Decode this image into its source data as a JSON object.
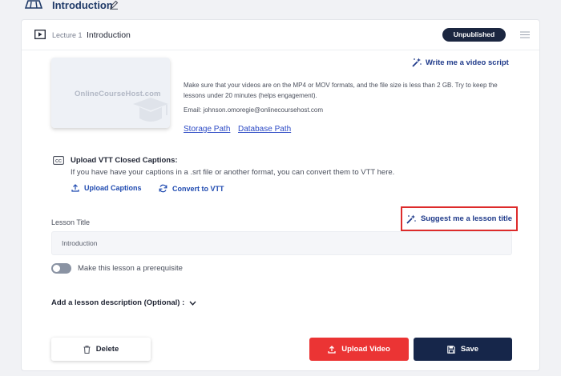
{
  "section": {
    "title": "Introduction"
  },
  "lecture": {
    "number_label": "Lecture 1",
    "title": "Introduction",
    "status": "Unpublished"
  },
  "video": {
    "thumbnail_brand": "OnlineCourseHost.com",
    "write_script_label": "Write me a video script",
    "info": "Make sure that your videos are on the MP4 or MOV formats, and the file size is less than 2 GB. Try to keep the lessons under 20 minutes (helps engagement).",
    "email": "Email: johnson.omoregie@onlinecoursehost.com",
    "storage_link": "Storage Path",
    "database_link": "Database Path"
  },
  "captions": {
    "title": "Upload VTT Closed Captions:",
    "description": "If you have have your captions in a .srt file or another format, you can convert them to VTT here.",
    "upload_label": "Upload Captions",
    "convert_label": "Convert to VTT"
  },
  "lesson": {
    "title_label": "Lesson Title",
    "suggest_label": "Suggest me a lesson title",
    "title_value": "Introduction",
    "prerequisite_label": "Make this lesson a prerequisite",
    "prerequisite_on": false,
    "description_toggle": "Add a lesson description (Optional) :"
  },
  "actions": {
    "delete_label": "Delete",
    "upload_label": "Upload Video",
    "save_label": "Save"
  },
  "colors": {
    "accent": "#1f3a8a",
    "danger": "#eb3434",
    "dark": "#16264a",
    "highlight": "#dd2b2b"
  },
  "icons": [
    "course-icon",
    "edit-icon",
    "play-icon",
    "menu-icon",
    "magic-wand-icon",
    "cc-icon",
    "upload-icon",
    "refresh-icon",
    "chevron-down-icon",
    "trash-icon",
    "save-icon"
  ]
}
